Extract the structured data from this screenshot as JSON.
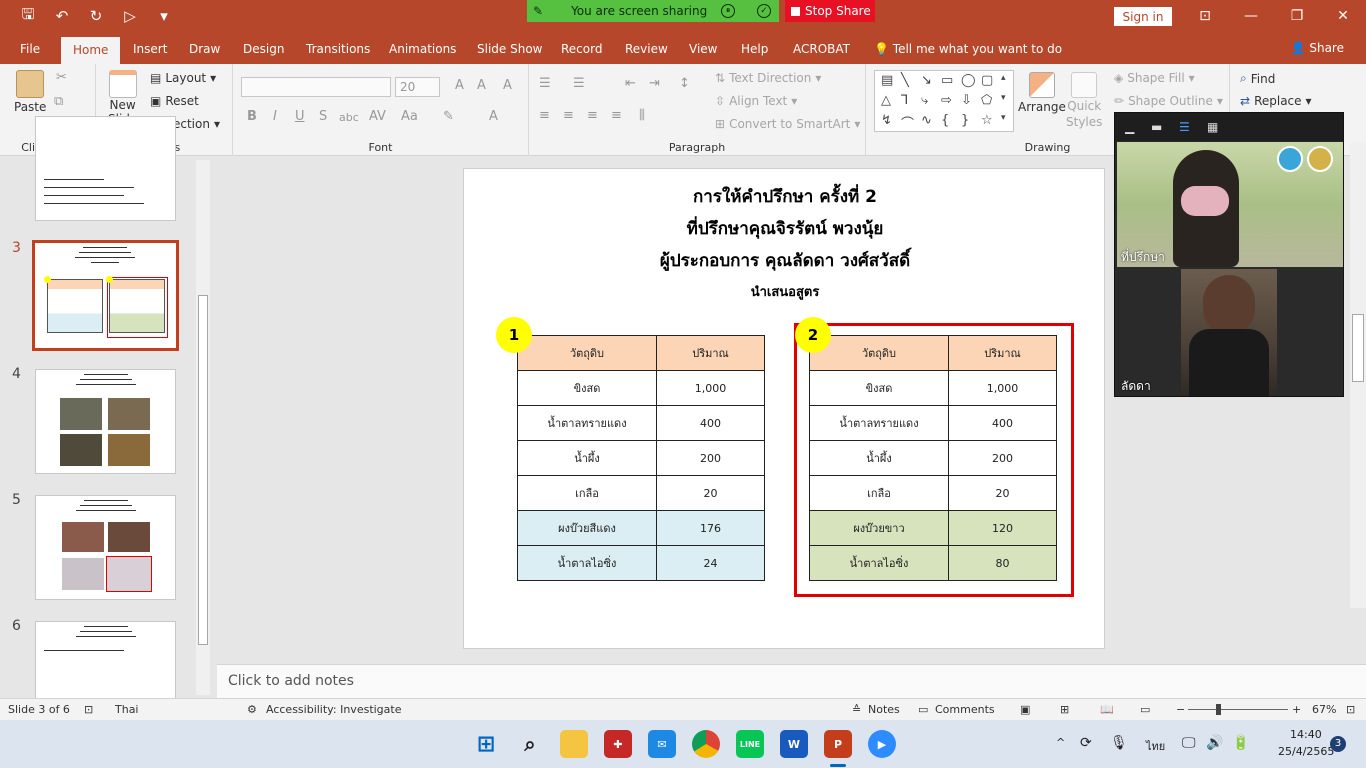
{
  "sharing": {
    "banner": "You are screen sharing",
    "stop": "Stop Share"
  },
  "titlebar": {
    "signin": "Sign in"
  },
  "menu": {
    "tabs": [
      "File",
      "Home",
      "Insert",
      "Draw",
      "Design",
      "Transitions",
      "Animations",
      "Slide Show",
      "Record",
      "Review",
      "View",
      "Help",
      "ACROBAT"
    ],
    "tell_me": "Tell me what you want to do",
    "share": "Share"
  },
  "ribbon": {
    "paste": "Paste",
    "new_slide_1": "New",
    "new_slide_2": "Slide",
    "layout": "Layout",
    "reset": "Reset",
    "section": "Section",
    "font_size": "20",
    "text_direction": "Text Direction",
    "align_text": "Align Text",
    "convert_smartart": "Convert to SmartArt",
    "arrange": "Arrange",
    "quick_styles_1": "Quick",
    "quick_styles_2": "Styles",
    "shape_fill": "Shape Fill",
    "shape_outline": "Shape Outline",
    "find": "Find",
    "replace": "Replace",
    "groups": {
      "clipboard": "Clipboard",
      "slides": "Slides",
      "font": "Font",
      "paragraph": "Paragraph",
      "drawing": "Drawing"
    }
  },
  "thumbnails": {
    "numbers": [
      "3",
      "4",
      "5",
      "6"
    ]
  },
  "slide": {
    "title1": "การให้คำปรึกษา ครั้งที่ 2",
    "title2": "ที่ปรึกษาคุณจิรรัตน์ พวงนุ้ย",
    "title3": "ผู้ประกอบการ คุณลัดดา วงศ์สวัสดิ์",
    "subtitle": "นำเสนอสูตร",
    "badge1": "1",
    "badge2": "2",
    "table1": {
      "headers": [
        "วัตถุดิบ",
        "ปริมาณ"
      ],
      "rows": [
        [
          "ขิงสด",
          "1,000"
        ],
        [
          "น้ำตาลทรายแดง",
          "400"
        ],
        [
          "น้ำผึ้ง",
          "200"
        ],
        [
          "เกลือ",
          "20"
        ],
        [
          "ผงบ๊วยสีแดง",
          "176"
        ],
        [
          "น้ำตาลไอซิ่ง",
          "24"
        ]
      ]
    },
    "table2": {
      "headers": [
        "วัตถุดิบ",
        "ปริมาณ"
      ],
      "rows": [
        [
          "ขิงสด",
          "1,000"
        ],
        [
          "น้ำตาลทรายแดง",
          "400"
        ],
        [
          "น้ำผึ้ง",
          "200"
        ],
        [
          "เกลือ",
          "20"
        ],
        [
          "ผงบ๊วยขาว",
          "120"
        ],
        [
          "น้ำตาลไอซิ่ง",
          "80"
        ]
      ]
    }
  },
  "video": {
    "participant1": "ที่ปรึกษา",
    "participant2": "ลัดดา"
  },
  "notes": {
    "placeholder": "Click to add notes"
  },
  "status": {
    "slide_of": "Slide 3 of 6",
    "language": "Thai",
    "accessibility": "Accessibility: Investigate",
    "notes": "Notes",
    "comments": "Comments",
    "zoom": "67%"
  },
  "taskbar": {
    "lang": "ไทย",
    "time": "14:40",
    "date": "25/4/2565",
    "notif": "3"
  },
  "colors": {
    "accent": "#b7472a",
    "header_fill": "#fbd5b5",
    "blue_fill": "#daeef3",
    "green_fill": "#d6e3bc",
    "red_box": "#e00000"
  }
}
